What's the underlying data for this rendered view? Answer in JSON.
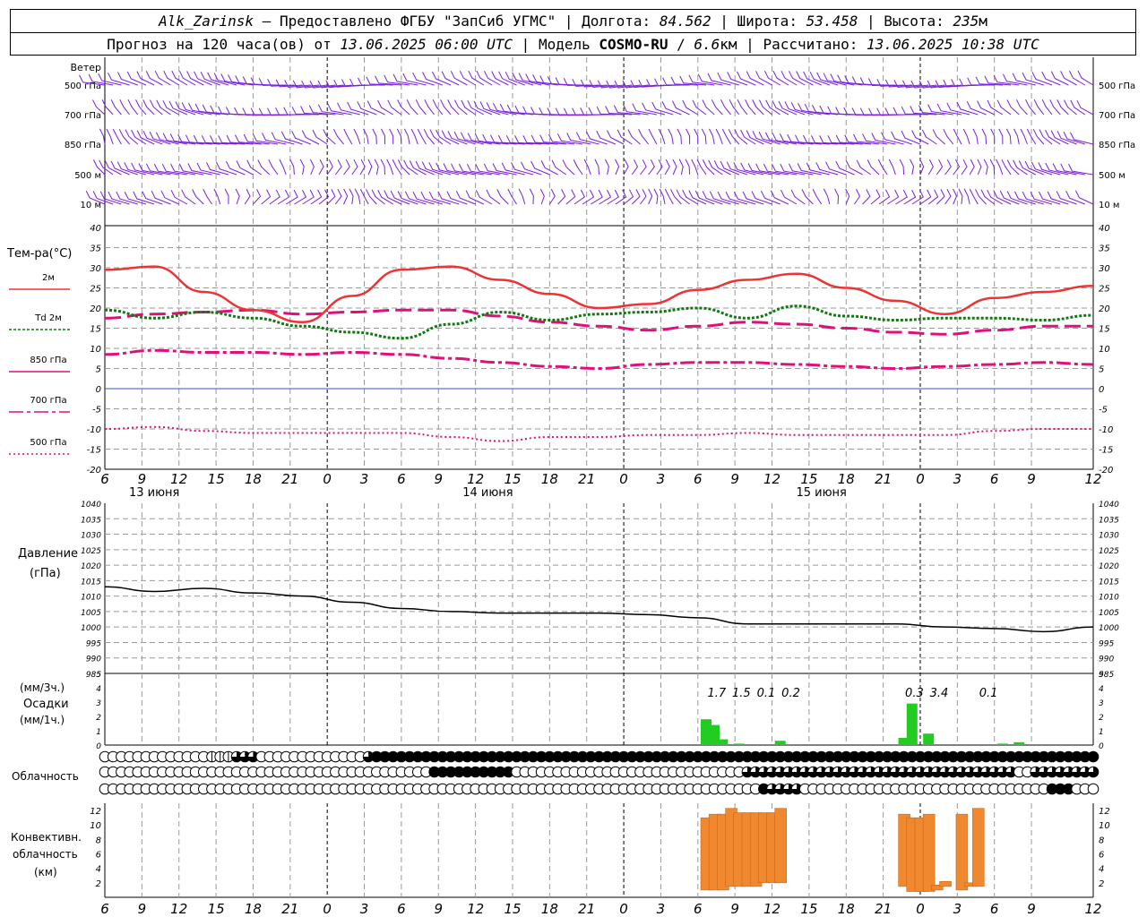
{
  "header": {
    "station": "Alk_Zarinsk",
    "provided_by": "Предоставлено ФГБУ \"ЗапСиб УГМС\"",
    "lon_label": "Долгота:",
    "lon": "84.562",
    "lat_label": "Широта:",
    "lat": "53.458",
    "alt_label": "Высота:",
    "alt": "235",
    "alt_unit": "м",
    "forecast_label": "Прогноз на 120 часа(ов) от",
    "forecast_start": "13.06.2025 06:00 UTC",
    "model_label": "Модель",
    "model": "COSMO-RU",
    "resolution": "6.6",
    "resolution_unit": "км",
    "calc_label": "Рассчитано:",
    "calc_time": "13.06.2025 10:38 UTC"
  },
  "colors": {
    "wind": "#7a1fe0",
    "t2m": "#ee3333",
    "td2m": "#117711",
    "t850": "#dd1177",
    "t700": "#dd1177",
    "t500": "#dd1177",
    "zero_line": "#3355cc",
    "pressure": "#000000",
    "precip": "#22cc22",
    "convective": "#f08830",
    "grid": "#999999"
  },
  "chart_data": {
    "type": "line",
    "x_time_ticks": [
      6,
      9,
      12,
      15,
      18,
      21,
      0,
      3,
      6,
      9,
      12,
      15,
      18,
      21,
      0,
      3,
      6,
      9,
      12,
      15,
      18,
      21,
      0,
      3,
      6,
      9,
      12
    ],
    "x_hours": [
      0,
      120
    ],
    "day_labels": [
      "13 июня",
      "14 июня",
      "15 июня"
    ],
    "wind": {
      "label": "Ветер",
      "levels": [
        "500 гПа",
        "700 гПа",
        "850 гПа",
        "500 м",
        "10   м"
      ]
    },
    "temperature": {
      "label": "Тем-ра(°C)",
      "ylim": [
        -20,
        40
      ],
      "yticks": [
        -20,
        -15,
        -10,
        -5,
        0,
        5,
        10,
        15,
        20,
        25,
        30,
        35,
        40
      ],
      "legend": [
        "2м",
        "Td  2м",
        "850 гПа",
        "700 гПа",
        "500 гПа"
      ],
      "hours": [
        0,
        6,
        12,
        18,
        24,
        30,
        36,
        42,
        48,
        54,
        60,
        66,
        72,
        78,
        84,
        90,
        96,
        102,
        108,
        114,
        120
      ],
      "t2m": [
        29.5,
        30.3,
        24,
        19.5,
        16.5,
        23,
        29.5,
        30.3,
        27,
        23.5,
        20,
        21,
        24.5,
        27,
        28.5,
        25,
        21.8,
        18.5,
        22.5,
        24,
        25.5
      ],
      "td2m": [
        19.5,
        17.5,
        19,
        17.5,
        15.5,
        14,
        12.5,
        16,
        19,
        17,
        18.5,
        19,
        20,
        17.5,
        20.5,
        18,
        17,
        17.5,
        17.5,
        17,
        18.2
      ],
      "t850": [
        8.5,
        9.5,
        9,
        9,
        8.5,
        9,
        8.5,
        7.5,
        6.5,
        5.5,
        5,
        6,
        6.5,
        6.5,
        6,
        5.5,
        5,
        5.5,
        6,
        6.5,
        6
      ],
      "t700": [
        17.5,
        18.5,
        19,
        19.5,
        18.5,
        19,
        19.5,
        19.5,
        18,
        16.5,
        15.5,
        14.5,
        15.5,
        16.5,
        16,
        15,
        14,
        13.5,
        14.5,
        15.5,
        15.5
      ],
      "t500": [
        -10,
        -9.5,
        -10.5,
        -11,
        -11,
        -11,
        -11,
        -12,
        -13,
        -12,
        -12,
        -11.5,
        -11.5,
        -11,
        -11.5,
        -11.5,
        -11.5,
        -11.5,
        -10.5,
        -10,
        -10
      ]
    },
    "pressure": {
      "label": "Давление",
      "unit": "(гПа)",
      "ylim": [
        985,
        1040
      ],
      "yticks": [
        985,
        990,
        995,
        1000,
        1005,
        1010,
        1015,
        1020,
        1025,
        1030,
        1035,
        1040
      ],
      "hours": [
        0,
        6,
        12,
        18,
        24,
        30,
        36,
        42,
        48,
        54,
        60,
        66,
        72,
        78,
        84,
        90,
        96,
        102,
        108,
        114,
        120
      ],
      "values": [
        1013,
        1011.5,
        1012.5,
        1011,
        1010,
        1008,
        1006,
        1005,
        1004.5,
        1004.5,
        1004.5,
        1004,
        1003,
        1001,
        1001,
        1001,
        1001,
        1000,
        999.5,
        998.5,
        1000
      ]
    },
    "precipitation": {
      "label": "Осадки",
      "unit_top": "(мм/3ч.)",
      "unit_bottom": "(мм/1ч.)",
      "ylim": [
        0,
        5
      ],
      "yticks": [
        0,
        1,
        2,
        3,
        4,
        5
      ],
      "sum_labels": [
        {
          "hour": 72,
          "text": "1.7"
        },
        {
          "hour": 75,
          "text": "1.5"
        },
        {
          "hour": 78,
          "text": "0.1"
        },
        {
          "hour": 81,
          "text": "0.2"
        },
        {
          "hour": 96,
          "text": "0.3"
        },
        {
          "hour": 99,
          "text": "3.4"
        },
        {
          "hour": 105,
          "text": "0.1"
        }
      ],
      "bars": [
        {
          "hour": 73,
          "value": 1.8
        },
        {
          "hour": 74,
          "value": 1.4
        },
        {
          "hour": 75,
          "value": 0.4
        },
        {
          "hour": 77,
          "value": 0.1
        },
        {
          "hour": 82,
          "value": 0.3
        },
        {
          "hour": 97,
          "value": 0.5
        },
        {
          "hour": 98,
          "value": 2.9
        },
        {
          "hour": 100,
          "value": 0.8
        },
        {
          "hour": 109,
          "value": 0.1
        },
        {
          "hour": 111,
          "value": 0.2
        }
      ]
    },
    "cloudiness": {
      "label": "Облачность",
      "rows": [
        "0000000000000111222000000000000024444444444444444444444444444444444444444444444444444444444444444444444444444444444444444",
        "0000000000000000000000000000000000000000444444444400000000000000000000000000002222222222222222222222222222222220022222222",
        "0000000000000000000000000000000000000000000000000000000000000000000000000000000042222000000000000000000000000000000444000"
      ]
    },
    "convective": {
      "label": "Конвективн.",
      "label2": "облачность",
      "unit": "(км)",
      "ylim": [
        0,
        13
      ],
      "yticks": [
        2,
        4,
        6,
        8,
        10,
        12
      ],
      "bars": [
        {
          "hour": 73,
          "base": 1,
          "top": 11
        },
        {
          "hour": 74,
          "base": 1,
          "top": 11.5
        },
        {
          "hour": 75,
          "base": 1,
          "top": 11.5
        },
        {
          "hour": 76,
          "base": 1.5,
          "top": 12.3
        },
        {
          "hour": 77,
          "base": 1.5,
          "top": 11.7
        },
        {
          "hour": 78,
          "base": 1.5,
          "top": 11.7
        },
        {
          "hour": 79,
          "base": 1.5,
          "top": 11.7
        },
        {
          "hour": 80,
          "base": 2,
          "top": 11.7
        },
        {
          "hour": 81,
          "base": 2,
          "top": 11.7
        },
        {
          "hour": 82,
          "base": 2,
          "top": 12.3
        },
        {
          "hour": 97,
          "base": 1.5,
          "top": 11.5
        },
        {
          "hour": 98,
          "base": 0.8,
          "top": 11
        },
        {
          "hour": 99,
          "base": 0.8,
          "top": 11
        },
        {
          "hour": 100,
          "base": 0.8,
          "top": 11.5
        },
        {
          "hour": 101,
          "base": 1,
          "top": 1.7
        },
        {
          "hour": 102,
          "base": 1.5,
          "top": 2.2
        },
        {
          "hour": 104,
          "base": 1,
          "top": 11.5
        },
        {
          "hour": 105,
          "base": 1.5,
          "top": 2
        },
        {
          "hour": 106,
          "base": 1.5,
          "top": 12.3
        }
      ]
    }
  }
}
